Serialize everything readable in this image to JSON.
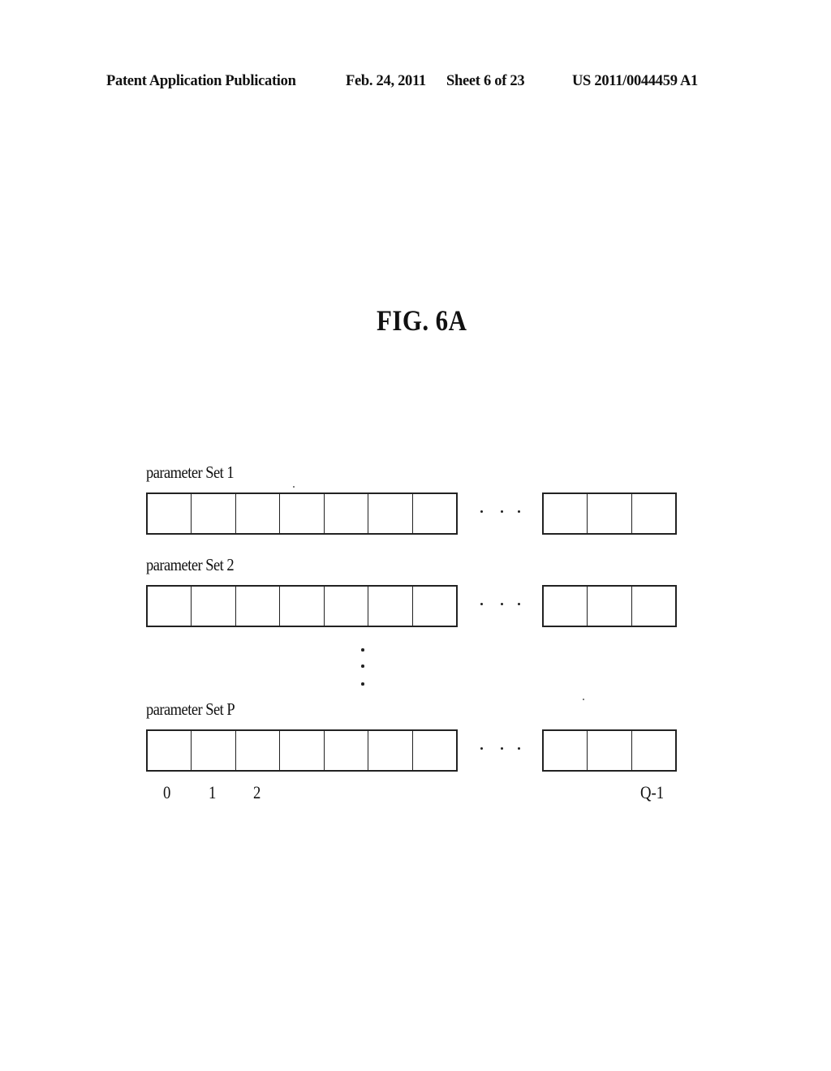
{
  "header": {
    "publication_type": "Patent Application Publication",
    "date": "Feb. 24, 2011",
    "sheet": "Sheet 6 of 23",
    "publication_number": "US 2011/0044459 A1"
  },
  "figure": {
    "title": "FIG. 6A",
    "parameter_sets": [
      {
        "label": "parameter Set 1",
        "left_cells": 7,
        "right_cells": 3,
        "gap_marker": ". . ."
      },
      {
        "label": "parameter Set 2",
        "left_cells": 7,
        "right_cells": 3,
        "gap_marker": ". . ."
      },
      {
        "label": "parameter Set P",
        "left_cells": 7,
        "right_cells": 3,
        "gap_marker": ". . ."
      }
    ],
    "vertical_ellipsis": "⋮",
    "index_labels": [
      "0",
      "1",
      "2",
      "Q-1"
    ]
  }
}
